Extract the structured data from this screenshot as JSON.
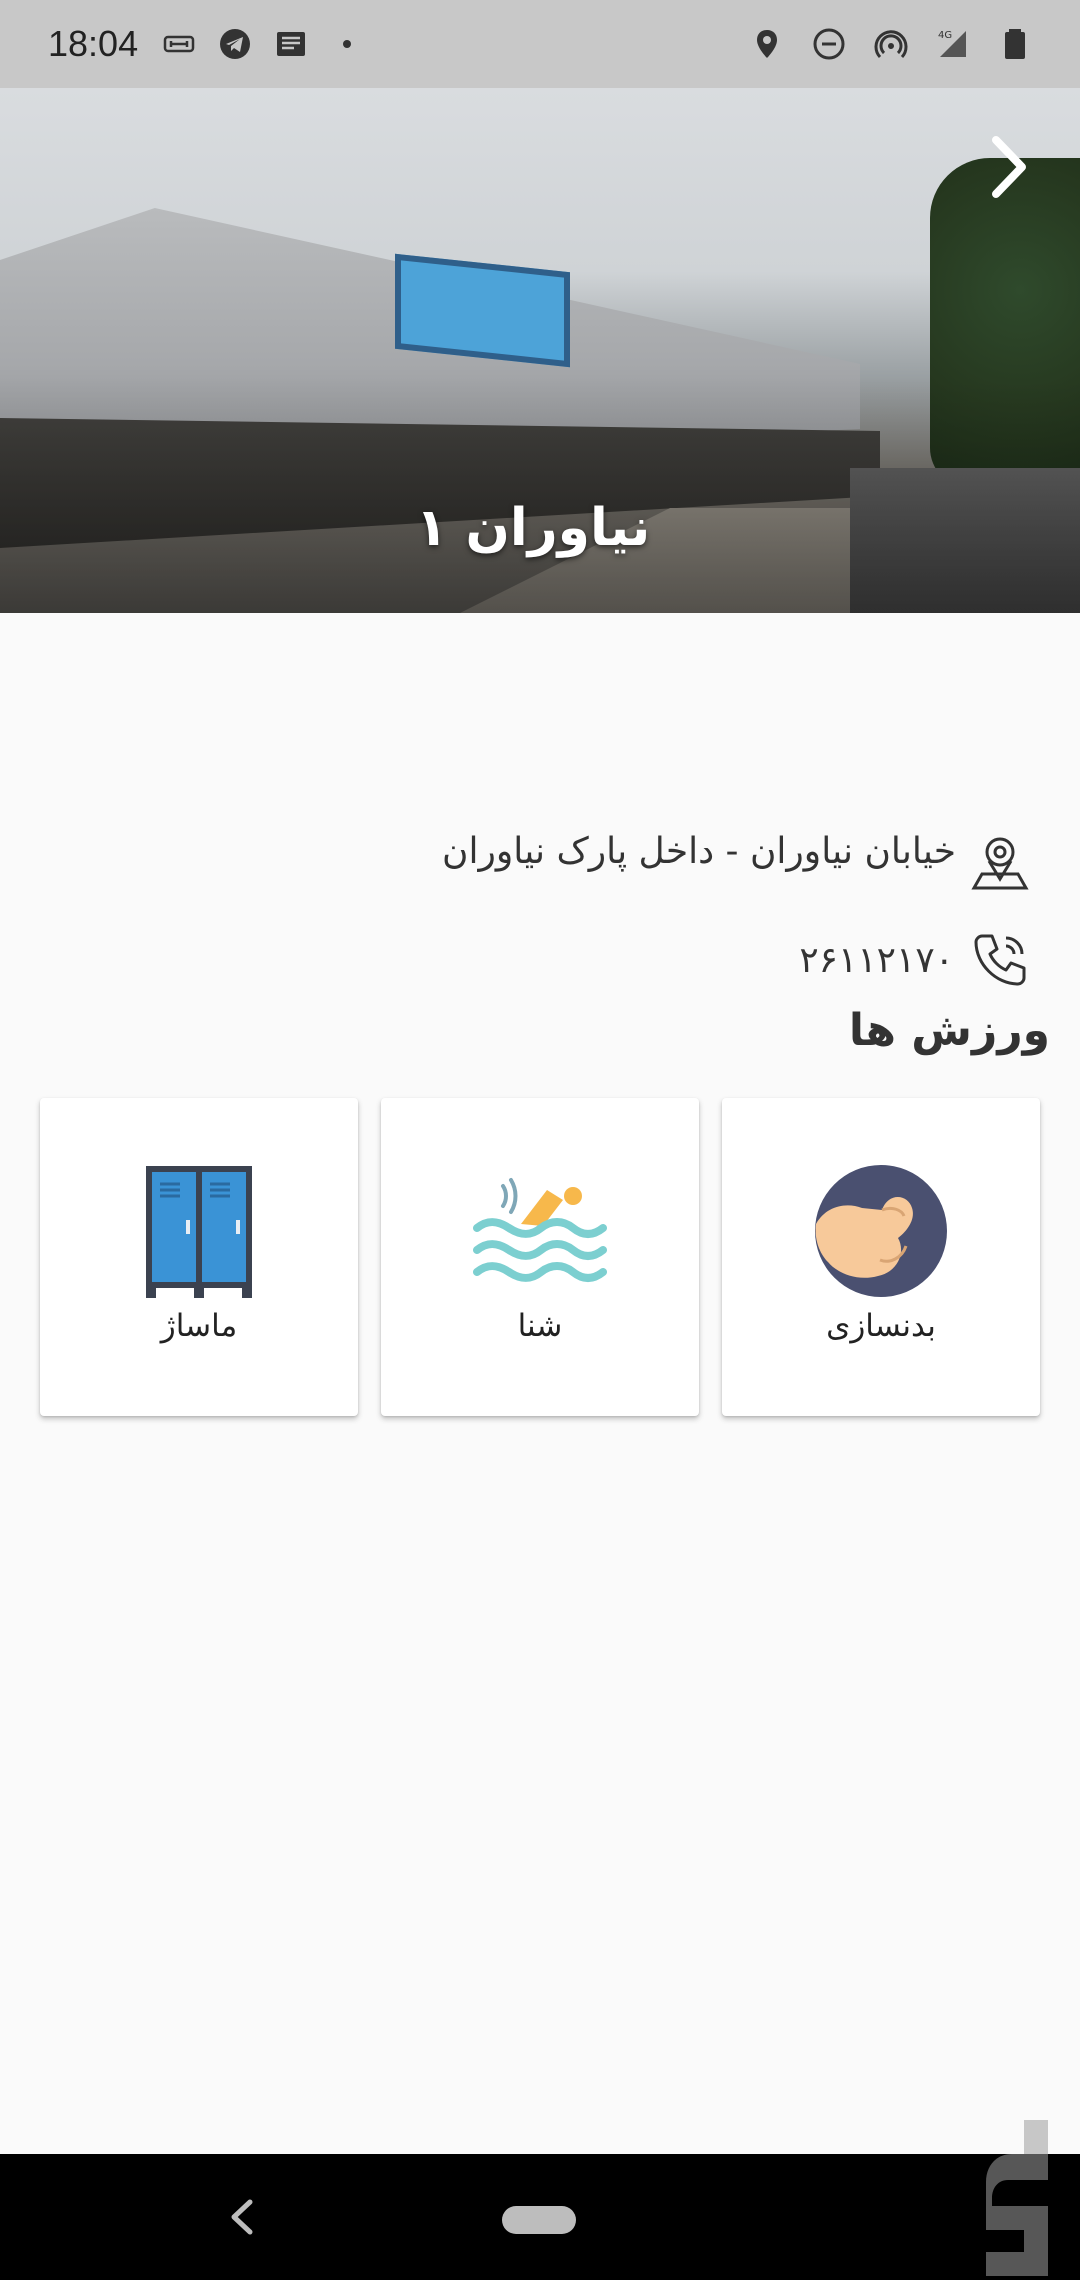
{
  "status_bar": {
    "time": "18:04",
    "left_icons": [
      "cast-icon",
      "telegram-icon",
      "news-icon",
      "dot-icon"
    ],
    "right_icons": [
      "location-icon",
      "dnd-icon",
      "hotspot-icon",
      "signal-4g-icon",
      "battery-icon"
    ]
  },
  "hero": {
    "title": "نیاوران ۱",
    "next_icon": "chevron-right-icon"
  },
  "info": {
    "address": "خیابان نیاوران - داخل پارک نیاوران",
    "address_icon": "map-pin-icon",
    "phone": "۲۶۱۱۲۱۷۰",
    "phone_icon": "phone-icon"
  },
  "sports": {
    "title": "ورزش ها",
    "items": [
      {
        "label": "بدنسازی",
        "icon": "bodybuilding-icon"
      },
      {
        "label": "شنا",
        "icon": "swimming-icon"
      },
      {
        "label": "ماساژ",
        "icon": "locker-icon"
      }
    ]
  },
  "nav": {
    "back_icon": "back-icon",
    "home_icon": "home-pill-icon"
  },
  "colors": {
    "background": "#fafafa",
    "status_bar": "#c8c8c8",
    "nav_bar": "#000000",
    "card": "#ffffff",
    "text": "#333333"
  }
}
